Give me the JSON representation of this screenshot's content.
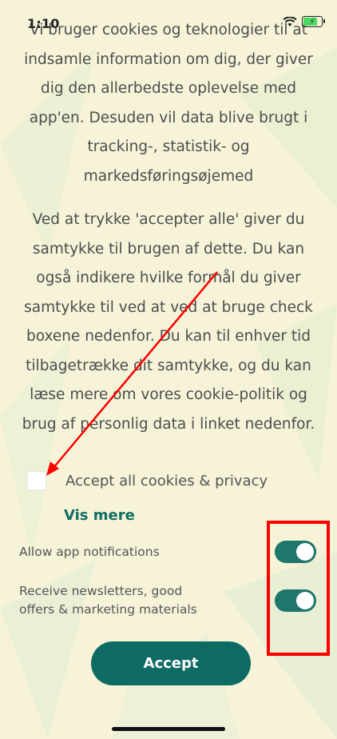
{
  "status_bar": {
    "time": "1:10"
  },
  "consent_text": {
    "paragraph_1": "Vi bruger cookies og teknologier til at indsamle information om dig, der giver dig den allerbedste oplevelse med app'en. Desuden vil data blive brugt i tracking-, statistik- og markedsføringsøjemed",
    "paragraph_2": "Ved at trykke 'accepter alle' giver du samtykke til brugen af dette. Du kan også indikere hvilke formål du giver samtykke til ved at ved at bruge check boxene nedenfor. Du kan til enhver tid tilbagetrække dit samtykke, og du kan læse mere om vores cookie-politik og brug af personlig data i linket nedenfor."
  },
  "accept_all": {
    "label": "Accept all cookies & privacy",
    "checked": false
  },
  "vis_mere": "Vis mere",
  "toggles": [
    {
      "label": "Allow app notifications",
      "on": true
    },
    {
      "label": "Receive newsletters, good offers & marketing materials",
      "on": true
    }
  ],
  "accept_button": "Accept",
  "colors": {
    "background": "#f6f3d8",
    "accent": "#0e6b63",
    "toggle_on": "#1f766c",
    "annotation": "#ff0000"
  }
}
